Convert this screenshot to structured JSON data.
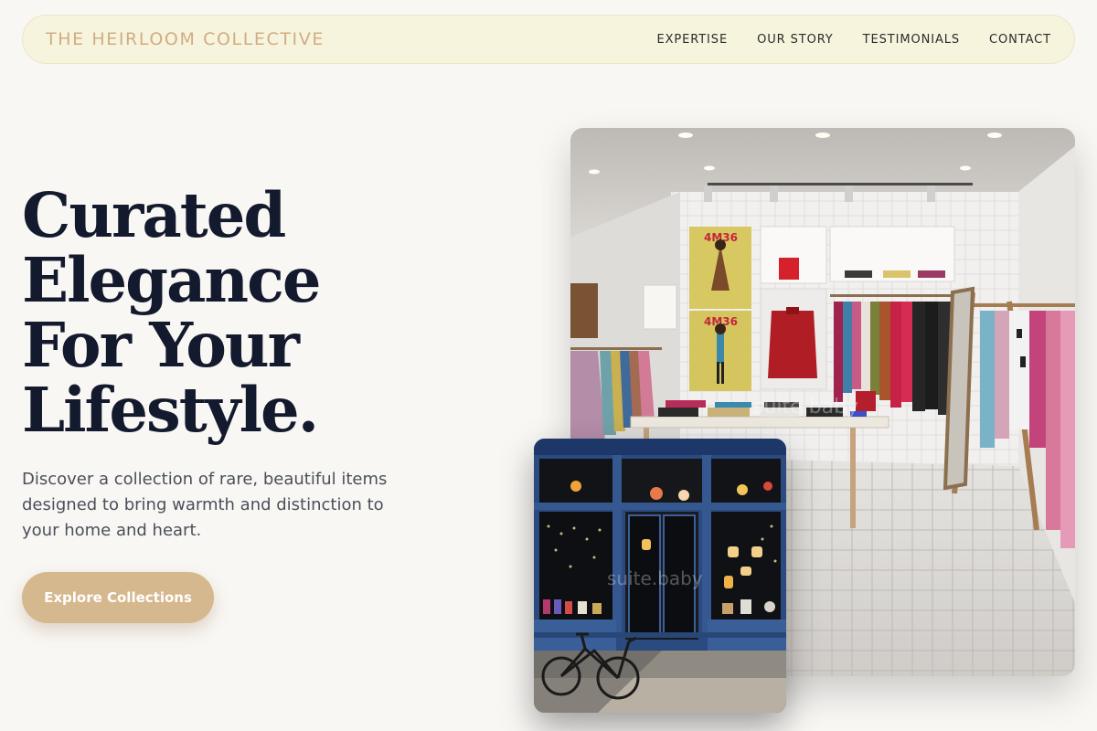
{
  "brand": "THE HEIRLOOM COLLECTIVE",
  "nav": {
    "links": [
      "EXPERTISE",
      "OUR STORY",
      "TESTIMONIALS",
      "CONTACT"
    ]
  },
  "hero": {
    "title_lines": [
      "Curated",
      "Elegance",
      "For Your",
      "Lifestyle."
    ],
    "subtitle": "Discover a collection of rare, beautiful items designed to bring warmth and distinction to your home and heart.",
    "cta_label": "Explore Collections"
  },
  "images": {
    "interior": {
      "poster_text": "4M36",
      "watermark": "suite.baby"
    },
    "storefront": {
      "watermark": "suite.baby"
    }
  },
  "colors": {
    "background": "#f9f7f4",
    "nav_background": "#f7f4de",
    "brand_accent": "#d0ad82",
    "heading": "#141a2e",
    "cta": "#d5b88d"
  }
}
